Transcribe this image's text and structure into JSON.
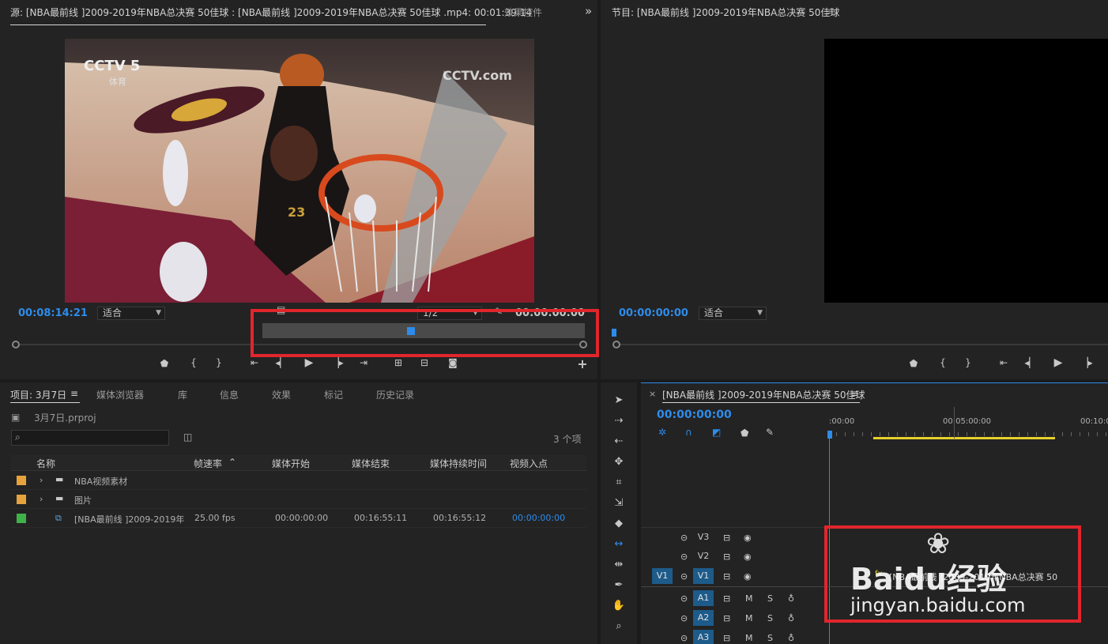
{
  "source_monitor": {
    "tab_title": "源: [NBA最前线 ]2009-2019年NBA总决赛 50佳球 : [NBA最前线 ]2009-2019年NBA总决赛 50佳球 .mp4: 00:01:39:14",
    "tab_effects": "效果控件",
    "overflow_icon": "»",
    "timecode_in": "00:08:14:21",
    "fit_label": "适合",
    "resolution_label": "1/2",
    "timecode_out": "00:00:00:00",
    "video_overlay": {
      "channel_logo": "CCTV 5",
      "channel_sub": "体育",
      "watermark": "CCTV.com",
      "jersey": "23"
    }
  },
  "program_monitor": {
    "tab_title": "节目: [NBA最前线 ]2009-2019年NBA总决赛 50佳球",
    "timecode": "00:00:00:00",
    "fit_label": "适合"
  },
  "project_panel": {
    "tabs": [
      "项目: 3月7日",
      "媒体浏览器",
      "库",
      "信息",
      "效果",
      "标记",
      "历史记录"
    ],
    "project_file": "3月7日.prproj",
    "search_placeholder": "",
    "item_count": "3 个项",
    "columns": [
      "名称",
      "帧速率",
      "媒体开始",
      "媒体结束",
      "媒体持续时间",
      "视频入点"
    ],
    "rows": [
      {
        "color": "#e6a23c",
        "type": "folder",
        "name": "NBA视频素材",
        "fps": "",
        "start": "",
        "end": "",
        "duration": "",
        "in": ""
      },
      {
        "color": "#e6a23c",
        "type": "folder",
        "name": "图片",
        "fps": "",
        "start": "",
        "end": "",
        "duration": "",
        "in": ""
      },
      {
        "color": "#3fb24a",
        "type": "sequence",
        "name": "[NBA最前线 ]2009-2019年",
        "fps": "25.00 fps",
        "start": "00:00:00:00",
        "end": "00:16:55:11",
        "duration": "00:16:55:12",
        "in": "00:00:00:00"
      }
    ]
  },
  "timeline": {
    "tab_title": "[NBA最前线 ]2009-2019年NBA总决赛 50佳球",
    "timecode": "00:00:00:00",
    "ruler": [
      ":00:00",
      "00:05:00:00",
      "00:10:0"
    ],
    "tracks_video": [
      "V3",
      "V2",
      "V1"
    ],
    "tracks_audio": [
      "A1",
      "A2",
      "A3"
    ],
    "source_patch": "V1",
    "audio_buttons": {
      "mute": "M",
      "solo": "S"
    },
    "clip_label": "[NBA最前线 ]2009-2019年NBA总决赛 50"
  },
  "watermark": {
    "brand": "Baidu经验",
    "url": "jingyan.baidu.com"
  },
  "colors": {
    "accent_blue": "#2d8ceb",
    "highlight_red": "#e0262c",
    "panel_bg": "#232323",
    "track_active": "#1d5b8a",
    "yellow_bar": "#e6d22a"
  }
}
